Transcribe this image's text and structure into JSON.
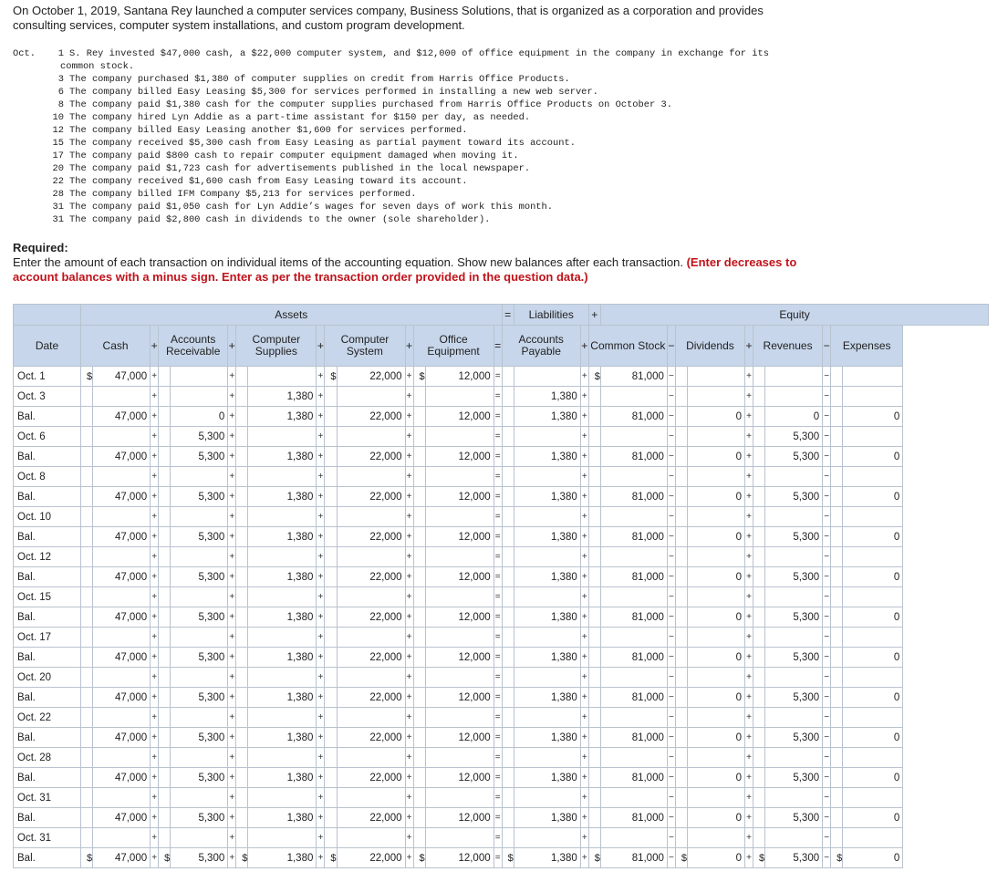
{
  "intro": "On October 1, 2019, Santana Rey launched a computer services company, Business Solutions, that is organized as a corporation and provides consulting services, computer system installations, and custom program development.",
  "month": "Oct.",
  "transactions": [
    {
      "day": "1",
      "text": "S. Rey invested $47,000 cash, a $22,000 computer system, and $12,000 of office equipment in the company in exchange for its"
    },
    {
      "day": "",
      "text": "common stock."
    },
    {
      "day": "3",
      "text": "The company purchased $1,380 of computer supplies on credit from Harris Office Products."
    },
    {
      "day": "6",
      "text": "The company billed Easy Leasing $5,300 for services performed in installing a new web server."
    },
    {
      "day": "8",
      "text": "The company paid $1,380 cash for the computer supplies purchased from Harris Office Products on October 3."
    },
    {
      "day": "10",
      "text": "The company hired Lyn Addie as a part-time assistant for $150 per day, as needed."
    },
    {
      "day": "12",
      "text": "The company billed Easy Leasing another $1,600 for services performed."
    },
    {
      "day": "15",
      "text": "The company received $5,300 cash from Easy Leasing as partial payment toward its account."
    },
    {
      "day": "17",
      "text": "The company paid $800 cash to repair computer equipment damaged when moving it."
    },
    {
      "day": "20",
      "text": "The company paid $1,723 cash for advertisements published in the local newspaper."
    },
    {
      "day": "22",
      "text": "The company received $1,600 cash from Easy Leasing toward its account."
    },
    {
      "day": "28",
      "text": "The company billed IFM Company $5,213 for services performed."
    },
    {
      "day": "31",
      "text": "The company paid $1,050 cash for Lyn Addie’s wages for seven days of work this month."
    },
    {
      "day": "31",
      "text": "The company paid $2,800 cash in dividends to the owner (sole shareholder)."
    }
  ],
  "required": {
    "label": "Required:",
    "text": "Enter the amount of each transaction on individual items of the accounting equation. Show new balances after each transaction.",
    "emphasis": "(Enter decreases to account balances with a minus sign. Enter as per the transaction order provided in the question data.)"
  },
  "table": {
    "group_assets": "Assets",
    "group_liabilities": "Liabilities",
    "group_equity": "Equity",
    "headers": {
      "date": "Date",
      "cash": "Cash",
      "ar": "Accounts Receivable",
      "supplies": "Computer Supplies",
      "system": "Computer System",
      "equipment": "Office Equipment",
      "ap": "Accounts Payable",
      "stock": "Common Stock",
      "dividends": "Dividends",
      "revenues": "Revenues",
      "expenses": "Expenses"
    },
    "currency": "$",
    "rows": [
      {
        "date": "Oct. 1",
        "bal": false,
        "cash": "47,000",
        "ar": "",
        "supplies": "",
        "system": "22,000",
        "equipment": "12,000",
        "ap": "",
        "stock": "81,000",
        "dividends": "",
        "revenues": "",
        "expenses": ""
      },
      {
        "date": "Oct. 3",
        "bal": false,
        "cash": "",
        "ar": "",
        "supplies": "1,380",
        "system": "",
        "equipment": "",
        "ap": "1,380",
        "stock": "",
        "dividends": "",
        "revenues": "",
        "expenses": ""
      },
      {
        "date": "Bal.",
        "bal": true,
        "cash": "47,000",
        "ar": "0",
        "supplies": "1,380",
        "system": "22,000",
        "equipment": "12,000",
        "ap": "1,380",
        "stock": "81,000",
        "dividends": "0",
        "revenues": "0",
        "expenses": "0"
      },
      {
        "date": "Oct. 6",
        "bal": false,
        "cash": "",
        "ar": "5,300",
        "supplies": "",
        "system": "",
        "equipment": "",
        "ap": "",
        "stock": "",
        "dividends": "",
        "revenues": "5,300",
        "expenses": ""
      },
      {
        "date": "Bal.",
        "bal": true,
        "cash": "47,000",
        "ar": "5,300",
        "supplies": "1,380",
        "system": "22,000",
        "equipment": "12,000",
        "ap": "1,380",
        "stock": "81,000",
        "dividends": "0",
        "revenues": "5,300",
        "expenses": "0"
      },
      {
        "date": "Oct. 8",
        "bal": false,
        "cash": "",
        "ar": "",
        "supplies": "",
        "system": "",
        "equipment": "",
        "ap": "",
        "stock": "",
        "dividends": "",
        "revenues": "",
        "expenses": ""
      },
      {
        "date": "Bal.",
        "bal": true,
        "cash": "47,000",
        "ar": "5,300",
        "supplies": "1,380",
        "system": "22,000",
        "equipment": "12,000",
        "ap": "1,380",
        "stock": "81,000",
        "dividends": "0",
        "revenues": "5,300",
        "expenses": "0"
      },
      {
        "date": "Oct. 10",
        "bal": false,
        "cash": "",
        "ar": "",
        "supplies": "",
        "system": "",
        "equipment": "",
        "ap": "",
        "stock": "",
        "dividends": "",
        "revenues": "",
        "expenses": ""
      },
      {
        "date": "Bal.",
        "bal": true,
        "cash": "47,000",
        "ar": "5,300",
        "supplies": "1,380",
        "system": "22,000",
        "equipment": "12,000",
        "ap": "1,380",
        "stock": "81,000",
        "dividends": "0",
        "revenues": "5,300",
        "expenses": "0"
      },
      {
        "date": "Oct. 12",
        "bal": false,
        "cash": "",
        "ar": "",
        "supplies": "",
        "system": "",
        "equipment": "",
        "ap": "",
        "stock": "",
        "dividends": "",
        "revenues": "",
        "expenses": ""
      },
      {
        "date": "Bal.",
        "bal": true,
        "cash": "47,000",
        "ar": "5,300",
        "supplies": "1,380",
        "system": "22,000",
        "equipment": "12,000",
        "ap": "1,380",
        "stock": "81,000",
        "dividends": "0",
        "revenues": "5,300",
        "expenses": "0"
      },
      {
        "date": "Oct. 15",
        "bal": false,
        "cash": "",
        "ar": "",
        "supplies": "",
        "system": "",
        "equipment": "",
        "ap": "",
        "stock": "",
        "dividends": "",
        "revenues": "",
        "expenses": ""
      },
      {
        "date": "Bal.",
        "bal": true,
        "cash": "47,000",
        "ar": "5,300",
        "supplies": "1,380",
        "system": "22,000",
        "equipment": "12,000",
        "ap": "1,380",
        "stock": "81,000",
        "dividends": "0",
        "revenues": "5,300",
        "expenses": "0"
      },
      {
        "date": "Oct. 17",
        "bal": false,
        "cash": "",
        "ar": "",
        "supplies": "",
        "system": "",
        "equipment": "",
        "ap": "",
        "stock": "",
        "dividends": "",
        "revenues": "",
        "expenses": ""
      },
      {
        "date": "Bal.",
        "bal": true,
        "cash": "47,000",
        "ar": "5,300",
        "supplies": "1,380",
        "system": "22,000",
        "equipment": "12,000",
        "ap": "1,380",
        "stock": "81,000",
        "dividends": "0",
        "revenues": "5,300",
        "expenses": "0"
      },
      {
        "date": "Oct. 20",
        "bal": false,
        "cash": "",
        "ar": "",
        "supplies": "",
        "system": "",
        "equipment": "",
        "ap": "",
        "stock": "",
        "dividends": "",
        "revenues": "",
        "expenses": ""
      },
      {
        "date": "Bal.",
        "bal": true,
        "cash": "47,000",
        "ar": "5,300",
        "supplies": "1,380",
        "system": "22,000",
        "equipment": "12,000",
        "ap": "1,380",
        "stock": "81,000",
        "dividends": "0",
        "revenues": "5,300",
        "expenses": "0"
      },
      {
        "date": "Oct. 22",
        "bal": false,
        "cash": "",
        "ar": "",
        "supplies": "",
        "system": "",
        "equipment": "",
        "ap": "",
        "stock": "",
        "dividends": "",
        "revenues": "",
        "expenses": ""
      },
      {
        "date": "Bal.",
        "bal": true,
        "cash": "47,000",
        "ar": "5,300",
        "supplies": "1,380",
        "system": "22,000",
        "equipment": "12,000",
        "ap": "1,380",
        "stock": "81,000",
        "dividends": "0",
        "revenues": "5,300",
        "expenses": "0"
      },
      {
        "date": "Oct. 28",
        "bal": false,
        "cash": "",
        "ar": "",
        "supplies": "",
        "system": "",
        "equipment": "",
        "ap": "",
        "stock": "",
        "dividends": "",
        "revenues": "",
        "expenses": ""
      },
      {
        "date": "Bal.",
        "bal": true,
        "cash": "47,000",
        "ar": "5,300",
        "supplies": "1,380",
        "system": "22,000",
        "equipment": "12,000",
        "ap": "1,380",
        "stock": "81,000",
        "dividends": "0",
        "revenues": "5,300",
        "expenses": "0"
      },
      {
        "date": "Oct. 31",
        "bal": false,
        "cash": "",
        "ar": "",
        "supplies": "",
        "system": "",
        "equipment": "",
        "ap": "",
        "stock": "",
        "dividends": "",
        "revenues": "",
        "expenses": ""
      },
      {
        "date": "Bal.",
        "bal": true,
        "cash": "47,000",
        "ar": "5,300",
        "supplies": "1,380",
        "system": "22,000",
        "equipment": "12,000",
        "ap": "1,380",
        "stock": "81,000",
        "dividends": "0",
        "revenues": "5,300",
        "expenses": "0"
      },
      {
        "date": "Oct. 31",
        "bal": false,
        "cash": "",
        "ar": "",
        "supplies": "",
        "system": "",
        "equipment": "",
        "ap": "",
        "stock": "",
        "dividends": "",
        "revenues": "",
        "expenses": ""
      },
      {
        "date": "Bal.",
        "bal": true,
        "final": true,
        "cash": "47,000",
        "ar": "5,300",
        "supplies": "1,380",
        "system": "22,000",
        "equipment": "12,000",
        "ap": "1,380",
        "stock": "81,000",
        "dividends": "0",
        "revenues": "5,300",
        "expenses": "0"
      }
    ]
  }
}
